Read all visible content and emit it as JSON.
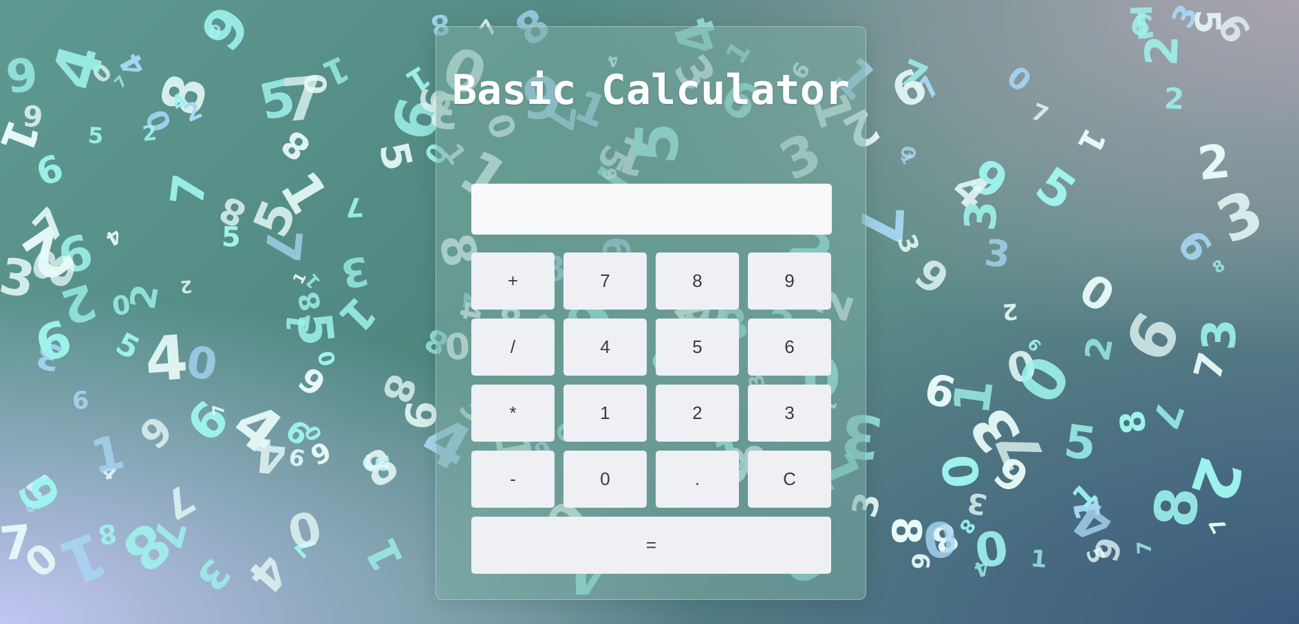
{
  "title": "Basic Calculator",
  "display": {
    "value": "",
    "placeholder": ""
  },
  "keys": [
    {
      "label": "+",
      "name": "add-button"
    },
    {
      "label": "7",
      "name": "digit-7-button"
    },
    {
      "label": "8",
      "name": "digit-8-button"
    },
    {
      "label": "9",
      "name": "digit-9-button"
    },
    {
      "label": "/",
      "name": "divide-button"
    },
    {
      "label": "4",
      "name": "digit-4-button"
    },
    {
      "label": "5",
      "name": "digit-5-button"
    },
    {
      "label": "6",
      "name": "digit-6-button"
    },
    {
      "label": "*",
      "name": "multiply-button"
    },
    {
      "label": "1",
      "name": "digit-1-button"
    },
    {
      "label": "2",
      "name": "digit-2-button"
    },
    {
      "label": "3",
      "name": "digit-3-button"
    },
    {
      "label": "-",
      "name": "subtract-button"
    },
    {
      "label": "0",
      "name": "digit-0-button"
    },
    {
      "label": ".",
      "name": "decimal-button"
    },
    {
      "label": "C",
      "name": "clear-button"
    }
  ],
  "equals": {
    "label": "=",
    "name": "equals-button"
  },
  "colors": {
    "digit_light": "#e8fbf8",
    "digit_cyan": "#9ff5ee",
    "digit_blue": "#a8d8f6",
    "panel": "#78aaa0",
    "key": "#eef0f4",
    "display": "#f8f9fb"
  }
}
